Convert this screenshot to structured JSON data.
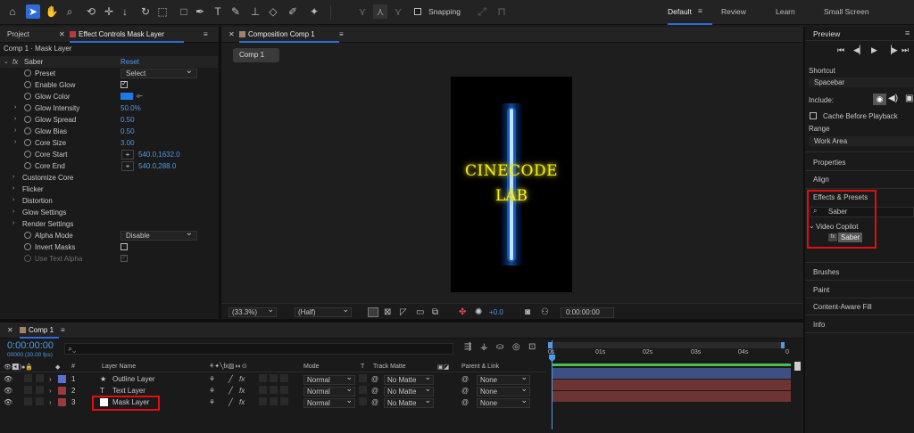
{
  "toolbar": {
    "snapping_label": "Snapping",
    "workspaces": [
      "Default",
      "Review",
      "Learn",
      "Small Screen"
    ]
  },
  "left_panel": {
    "tabs": [
      "Project",
      "Effect Controls Mask Layer"
    ],
    "breadcrumb": "Comp 1 · Mask Layer",
    "effect_name": "Saber",
    "reset_label": "Reset",
    "rows": [
      {
        "label": "Preset",
        "value": "Select"
      },
      {
        "label": "Enable Glow",
        "value": ""
      },
      {
        "label": "Glow Color",
        "value": ""
      },
      {
        "label": "Glow Intensity",
        "value": "50.0%"
      },
      {
        "label": "Glow Spread",
        "value": "0.50"
      },
      {
        "label": "Glow Bias",
        "value": "0.50"
      },
      {
        "label": "Core Size",
        "value": "3.00"
      },
      {
        "label": "Core Start",
        "value": "540.0,1632.0"
      },
      {
        "label": "Core End",
        "value": "540.0,288.0"
      },
      {
        "label": "Customize Core",
        "value": ""
      },
      {
        "label": "Flicker",
        "value": ""
      },
      {
        "label": "Distortion",
        "value": ""
      },
      {
        "label": "Glow Settings",
        "value": ""
      },
      {
        "label": "Render Settings",
        "value": ""
      },
      {
        "label": "Alpha Mode",
        "value": "Disable"
      },
      {
        "label": "Invert Masks",
        "value": ""
      },
      {
        "label": "Use Text Alpha",
        "value": ""
      }
    ],
    "glow_color": "#1e7be6"
  },
  "composition": {
    "tab_label": "Composition Comp 1",
    "sub_tab": "Comp 1",
    "text_line1": "CINECODE",
    "text_line2": "LAB",
    "zoom": "(33.3%)",
    "resolution": "(Half)",
    "exposure": "+0.0",
    "timecode": "0:00:00:00",
    "saber_color": "#3aa0ff",
    "text_color": "#e6e020"
  },
  "timeline": {
    "tab_label": "Comp 1",
    "timecode": "0:00:00:00",
    "frames": "00000 (30.00 fps)",
    "headers": {
      "layer_name": "Layer Name",
      "mode": "Mode",
      "t": "T",
      "track_matte": "Track Matte",
      "parent": "Parent & Link",
      "num": "#"
    },
    "ruler": [
      "0s",
      "01s",
      "02s",
      "03s",
      "04s",
      "0"
    ],
    "layers": [
      {
        "num": "1",
        "name": "Outline Layer",
        "mode": "Normal",
        "matte": "No Matte",
        "parent": "None",
        "color": "#5a6fd0",
        "bar": "#3e4f84"
      },
      {
        "num": "2",
        "name": "Text Layer",
        "mode": "Normal",
        "matte": "No Matte",
        "parent": "None",
        "color": "#9a3a3a",
        "bar": "#6e3434"
      },
      {
        "num": "3",
        "name": "Mask Layer",
        "mode": "Normal",
        "matte": "No Matte",
        "parent": "None",
        "color": "#9a3a3a",
        "bar": "#6e3434"
      }
    ]
  },
  "right_panel": {
    "preview_title": "Preview",
    "shortcut_label": "Shortcut",
    "shortcut_value": "Spacebar",
    "include_label": "Include:",
    "cache_label": "Cache Before Playback",
    "range_label": "Range",
    "range_value": "Work Area",
    "sections": [
      "Properties",
      "Align",
      "Effects & Presets",
      "Brushes",
      "Paint",
      "Content-Aware Fill",
      "Info"
    ],
    "search_value": "Saber",
    "folder_label": "Video Copilot",
    "effect_item": "Saber"
  }
}
